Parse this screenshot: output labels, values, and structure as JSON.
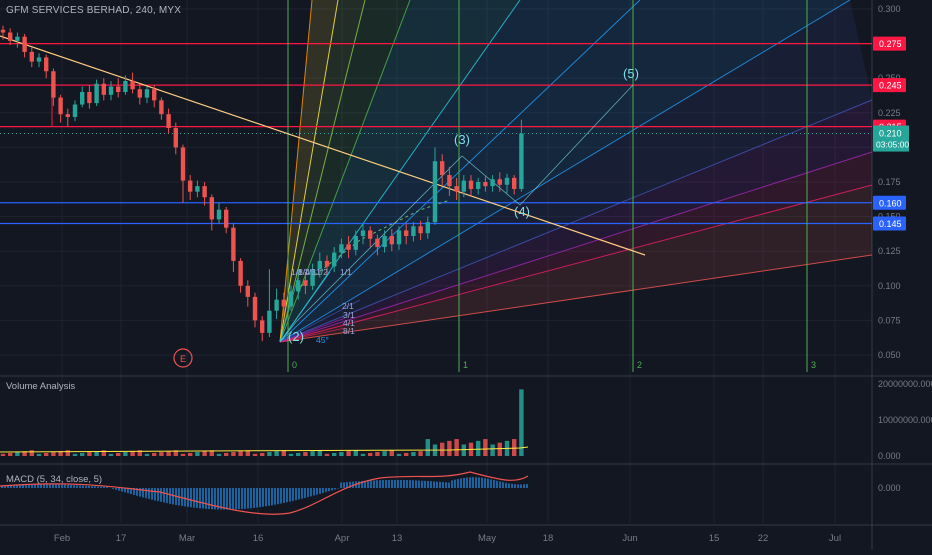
{
  "header": {
    "symbol": "GFM SERVICES BERHAD",
    "interval": "240",
    "exchange": "MYX",
    "title": "GFM SERVICES BERHAD, 240, MYX"
  },
  "colors": {
    "background": "#131722",
    "up": "#26a69a",
    "down": "#ef5350",
    "grid": "#1f2331",
    "axis_text": "#787b86",
    "horizontal_red": "#ff1744",
    "horizontal_blue": "#2962ff",
    "trendline": "#ffcc80",
    "fib_vertical": "#4caf50",
    "wave_label": "#80deea",
    "macd_hist": "#2196f3"
  },
  "chart_data": [
    {
      "type": "candlestick",
      "pane": "price",
      "title": "GFM SERVICES BERHAD, 240, MYX",
      "x_tick_labels": [
        "Feb",
        "17",
        "Mar",
        "16",
        "Apr",
        "13",
        "May",
        "18",
        "Jun",
        "15",
        "22",
        "Jul"
      ],
      "y_ticks": [
        0.05,
        0.075,
        0.1,
        0.125,
        0.15,
        0.175,
        0.2,
        0.225,
        0.25,
        0.275,
        0.3
      ],
      "y_tick_labels": [
        "0.050",
        "0.075",
        "0.100",
        "0.125",
        "0.150",
        "0.175",
        "0.200",
        "0.225",
        "0.250",
        "0.275",
        "0.300"
      ],
      "ylim": [
        0.04,
        0.3
      ],
      "candles": [
        [
          0.285,
          0.283,
          0.288,
          0.278
        ],
        [
          0.283,
          0.277,
          0.286,
          0.274
        ],
        [
          0.277,
          0.28,
          0.283,
          0.272
        ],
        [
          0.28,
          0.269,
          0.282,
          0.265
        ],
        [
          0.269,
          0.262,
          0.272,
          0.258
        ],
        [
          0.262,
          0.265,
          0.268,
          0.258
        ],
        [
          0.265,
          0.255,
          0.267,
          0.25
        ],
        [
          0.255,
          0.236,
          0.257,
          0.23
        ],
        [
          0.236,
          0.224,
          0.238,
          0.218
        ],
        [
          0.224,
          0.222,
          0.228,
          0.215
        ],
        [
          0.222,
          0.231,
          0.234,
          0.219
        ],
        [
          0.231,
          0.24,
          0.244,
          0.229
        ],
        [
          0.24,
          0.232,
          0.245,
          0.228
        ],
        [
          0.232,
          0.246,
          0.249,
          0.23
        ],
        [
          0.246,
          0.238,
          0.25,
          0.234
        ],
        [
          0.238,
          0.244,
          0.248,
          0.234
        ],
        [
          0.244,
          0.24,
          0.25,
          0.236
        ],
        [
          0.24,
          0.248,
          0.252,
          0.238
        ],
        [
          0.248,
          0.242,
          0.254,
          0.239
        ],
        [
          0.242,
          0.236,
          0.246,
          0.231
        ],
        [
          0.236,
          0.242,
          0.244,
          0.232
        ],
        [
          0.242,
          0.234,
          0.245,
          0.229
        ],
        [
          0.234,
          0.224,
          0.236,
          0.22
        ],
        [
          0.224,
          0.214,
          0.228,
          0.21
        ],
        [
          0.214,
          0.2,
          0.218,
          0.195
        ],
        [
          0.2,
          0.176,
          0.202,
          0.16
        ],
        [
          0.176,
          0.168,
          0.18,
          0.162
        ],
        [
          0.168,
          0.172,
          0.176,
          0.164
        ],
        [
          0.172,
          0.164,
          0.175,
          0.158
        ],
        [
          0.164,
          0.148,
          0.166,
          0.14
        ],
        [
          0.148,
          0.155,
          0.16,
          0.145
        ],
        [
          0.155,
          0.142,
          0.157,
          0.138
        ],
        [
          0.142,
          0.118,
          0.145,
          0.11
        ],
        [
          0.118,
          0.1,
          0.12,
          0.095
        ],
        [
          0.1,
          0.092,
          0.104,
          0.085
        ],
        [
          0.092,
          0.075,
          0.095,
          0.07
        ],
        [
          0.075,
          0.066,
          0.078,
          0.06
        ],
        [
          0.066,
          0.082,
          0.112,
          0.063
        ],
        [
          0.082,
          0.09,
          0.098,
          0.076
        ],
        [
          0.09,
          0.085,
          0.095,
          0.078
        ],
        [
          0.085,
          0.096,
          0.1,
          0.082
        ],
        [
          0.096,
          0.104,
          0.112,
          0.09
        ],
        [
          0.104,
          0.1,
          0.11,
          0.094
        ],
        [
          0.1,
          0.112,
          0.116,
          0.097
        ],
        [
          0.112,
          0.118,
          0.124,
          0.106
        ],
        [
          0.118,
          0.114,
          0.122,
          0.108
        ],
        [
          0.114,
          0.124,
          0.128,
          0.11
        ],
        [
          0.124,
          0.13,
          0.134,
          0.12
        ],
        [
          0.13,
          0.126,
          0.136,
          0.12
        ],
        [
          0.126,
          0.136,
          0.14,
          0.122
        ],
        [
          0.136,
          0.14,
          0.145,
          0.13
        ],
        [
          0.14,
          0.134,
          0.143,
          0.128
        ],
        [
          0.134,
          0.128,
          0.137,
          0.122
        ],
        [
          0.128,
          0.136,
          0.14,
          0.124
        ],
        [
          0.136,
          0.13,
          0.141,
          0.125
        ],
        [
          0.13,
          0.14,
          0.143,
          0.126
        ],
        [
          0.14,
          0.136,
          0.145,
          0.13
        ],
        [
          0.136,
          0.143,
          0.146,
          0.132
        ],
        [
          0.143,
          0.138,
          0.147,
          0.133
        ],
        [
          0.138,
          0.146,
          0.15,
          0.134
        ],
        [
          0.146,
          0.19,
          0.2,
          0.144
        ],
        [
          0.19,
          0.18,
          0.195,
          0.172
        ],
        [
          0.18,
          0.172,
          0.186,
          0.165
        ],
        [
          0.172,
          0.168,
          0.178,
          0.162
        ],
        [
          0.168,
          0.176,
          0.18,
          0.164
        ],
        [
          0.176,
          0.17,
          0.18,
          0.165
        ],
        [
          0.17,
          0.175,
          0.178,
          0.166
        ],
        [
          0.175,
          0.172,
          0.179,
          0.168
        ],
        [
          0.172,
          0.177,
          0.18,
          0.168
        ],
        [
          0.177,
          0.173,
          0.182,
          0.168
        ],
        [
          0.173,
          0.178,
          0.181,
          0.167
        ],
        [
          0.178,
          0.17,
          0.18,
          0.166
        ],
        [
          0.17,
          0.21,
          0.22,
          0.168
        ]
      ],
      "horizontal_lines": [
        {
          "value": 0.275,
          "color": "#ff1744",
          "label": "0.275"
        },
        {
          "value": 0.245,
          "color": "#ff1744",
          "label": "0.245"
        },
        {
          "value": 0.215,
          "color": "#ff1744",
          "label": "0.215"
        },
        {
          "value": 0.16,
          "color": "#2962ff",
          "label": "0.160"
        },
        {
          "value": 0.145,
          "color": "#2962ff",
          "label": "0.145"
        }
      ],
      "last_price": {
        "value": 0.21,
        "label": "0.210",
        "countdown": "03:05:00"
      },
      "wave_labels": [
        "(2)",
        "(3)",
        "(4)",
        "(5)"
      ],
      "event_marker": "E",
      "fib_time_labels": [
        "0",
        "1",
        "2",
        "3"
      ],
      "gann_labels": [
        "1/8",
        "1/4",
        "1/3",
        "1/2",
        "2/1",
        "1/1",
        "3/1",
        "4/1",
        "8/1",
        "45°"
      ]
    },
    {
      "type": "bar",
      "pane": "volume",
      "title": "Volume Analysis",
      "y_ticks": [
        0,
        10000000,
        20000000
      ],
      "y_tick_labels": [
        "0.000",
        "10000000.000",
        "20000000.000"
      ],
      "ylim": [
        0,
        20000000
      ]
    },
    {
      "type": "bar",
      "pane": "macd",
      "title": "MACD (5, 34, close, 5)",
      "y_ticks": [
        0
      ],
      "y_tick_labels": [
        "0.000"
      ]
    }
  ]
}
